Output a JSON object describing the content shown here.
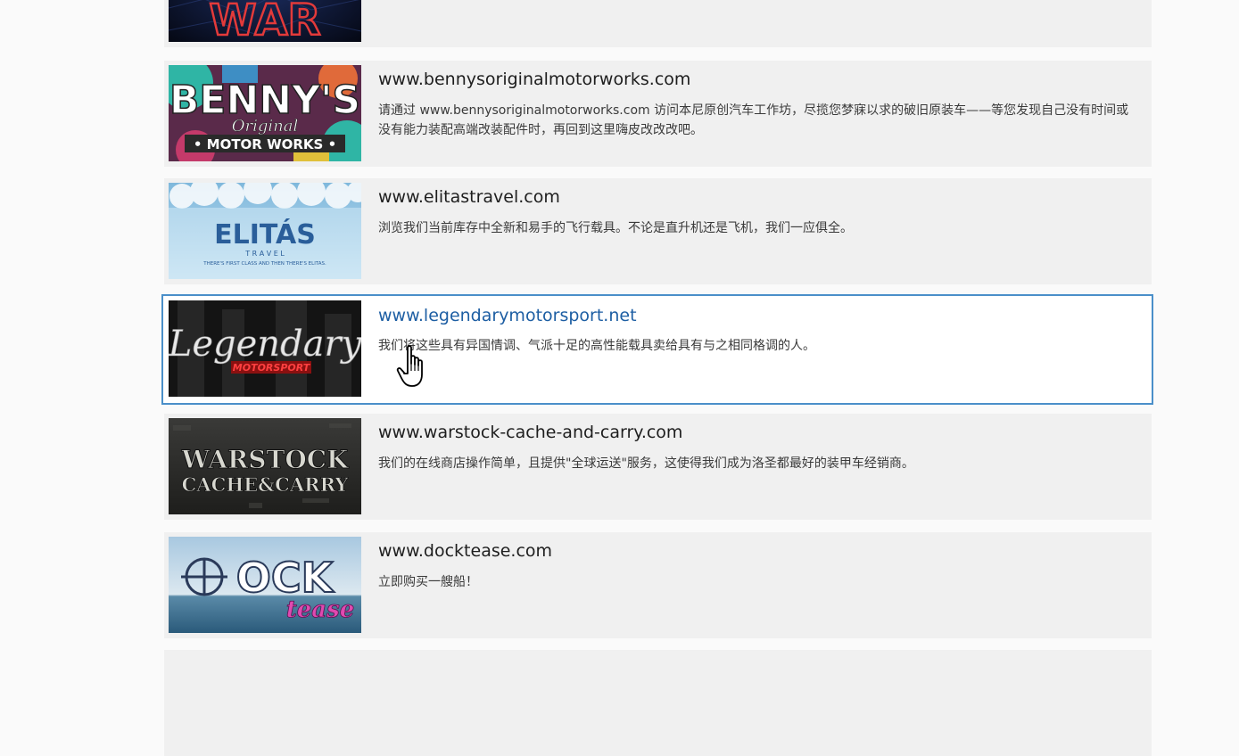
{
  "sites": [
    {
      "id": "war",
      "logo_icon": "war-logo-icon",
      "logo_text": "WAR",
      "title": "",
      "description": ""
    },
    {
      "id": "bennys",
      "logo_icon": "bennys-logo-icon",
      "logo_text": "BENNY'S",
      "logo_sub1": "Original",
      "logo_sub2": "• MOTOR WORKS •",
      "title": "www.bennysoriginalmotorworks.com",
      "description": "请通过 www.bennysoriginalmotorworks.com 访问本尼原创汽车工作坊，尽揽您梦寐以求的破旧原装车——等您发现自己没有时间或没有能力装配高端改装配件时，再回到这里嗨皮改改改吧。"
    },
    {
      "id": "elitas",
      "logo_icon": "elitas-logo-icon",
      "logo_text": "ELITÁS",
      "logo_sub1": "T R A V E L",
      "logo_sub2": "THERE'S FIRST CLASS AND THEN THERE'S ELITAS.",
      "title": "www.elitastravel.com",
      "description": "浏览我们当前库存中全新和易手的飞行载具。不论是直升机还是飞机，我们一应俱全。"
    },
    {
      "id": "legendary",
      "logo_icon": "legendary-logo-icon",
      "logo_text": "Legendary",
      "logo_sub1": "MOTORSPORT",
      "title": "www.legendarymotorsport.net",
      "description": "我们将这些具有异国情调、气派十足的高性能载具卖给具有与之相同格调的人。",
      "selected": true
    },
    {
      "id": "warstock",
      "logo_icon": "warstock-logo-icon",
      "logo_text": "WARSTOCK",
      "logo_sub1": "CACHE&CARRY",
      "title": "www.warstock-cache-and-carry.com",
      "description": "我们的在线商店操作简单，且提供\"全球运送\"服务，这使得我们成为洛圣都最好的装甲车经销商。"
    },
    {
      "id": "docktease",
      "logo_icon": "docktease-logo-icon",
      "logo_text": "OCK",
      "logo_sub1": "tease",
      "title": "www.docktease.com",
      "description": "立即购买一艘船！"
    }
  ],
  "colors": {
    "card_bg": "#f0f0f0",
    "selected_border": "#4a8fc9",
    "selected_title": "#1d5ea3",
    "page_bg": "#fafafa"
  },
  "cursor_icon": "hand-pointer-icon"
}
